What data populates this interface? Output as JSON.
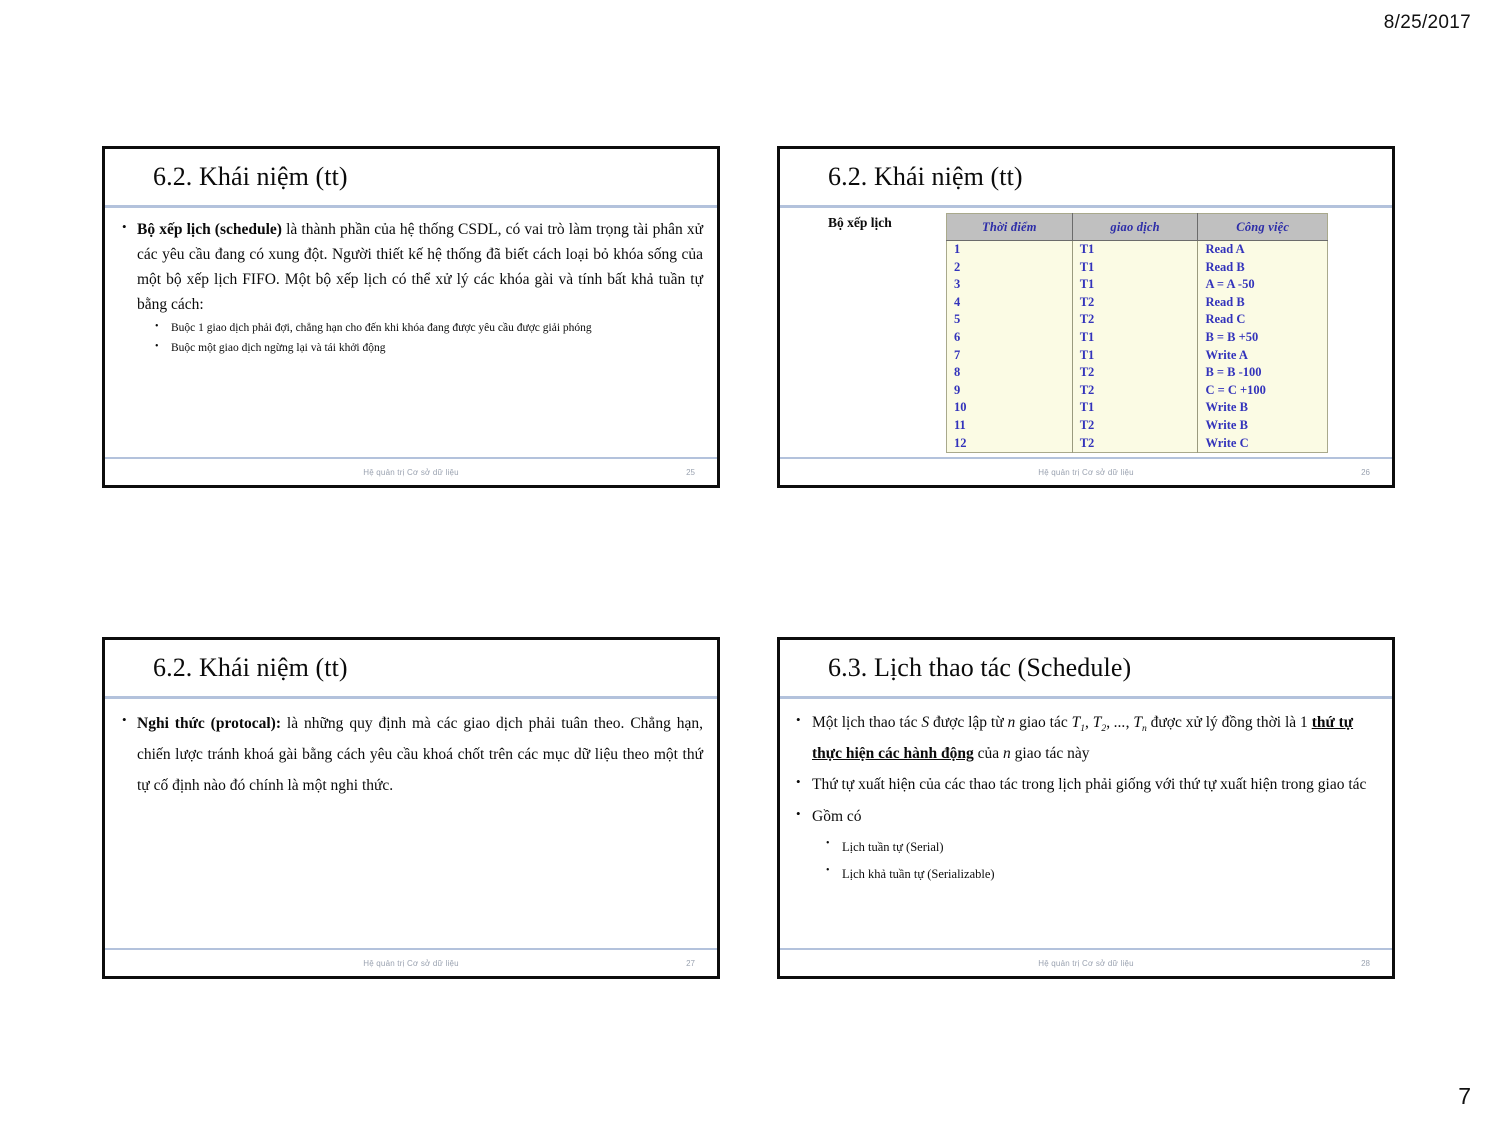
{
  "page": {
    "date": "8/25/2017",
    "number": "7"
  },
  "slides": [
    {
      "id": "slide-25",
      "title": "6.2. Khái niệm (tt)",
      "footer_text": "Hệ quản trị Cơ sở dữ liệu",
      "footer_number": "25",
      "bullets": [
        {
          "level": 1,
          "bold_lead": "Bộ xếp lịch (schedule)",
          "text": " là thành phần của hệ thống  CSDL, có vai trò làm trọng tài phân xử các yêu cầu  đang có xung đột. Người thiết kế hệ thống đã biết cách  loại bỏ khóa sống của một bộ xếp lịch FIFO. Một bộ  xếp lịch có thể xử lý các khóa gài và tính bất khả tuần tự bằng cách:"
        },
        {
          "level": 2,
          "text": "Buộc 1 giao dịch phải đợi, chẳng hạn cho đến khi  khóa đang được yêu cầu được giải phóng"
        },
        {
          "level": 2,
          "text": "Buộc một giao dịch ngừng lại và tái khởi động"
        }
      ]
    },
    {
      "id": "slide-26",
      "title": "6.2. Khái niệm (tt)",
      "footer_text": "Hệ quản trị Cơ sở dữ liệu",
      "footer_number": "26",
      "schedule_label": "Bộ xếp lịch",
      "table": {
        "headers": [
          "Thời điểm",
          "giao dịch",
          "Công việc"
        ],
        "rows": [
          [
            "1",
            "T1",
            "Read A"
          ],
          [
            "2",
            "T1",
            "Read B"
          ],
          [
            "3",
            "T1",
            "A = A -50"
          ],
          [
            "4",
            "T2",
            "Read B"
          ],
          [
            "5",
            "T2",
            "Read C"
          ],
          [
            "6",
            "T1",
            "B = B +50"
          ],
          [
            "7",
            "T1",
            "Write A"
          ],
          [
            "8",
            "T2",
            "B = B -100"
          ],
          [
            "9",
            "T2",
            "C = C +100"
          ],
          [
            "10",
            "T1",
            "Write B"
          ],
          [
            "11",
            "T2",
            "Write B"
          ],
          [
            "12",
            "T2",
            "Write C"
          ]
        ]
      }
    },
    {
      "id": "slide-27",
      "title": "6.2. Khái niệm (tt)",
      "footer_text": "Hệ quản trị Cơ sở dữ liệu",
      "footer_number": "27",
      "bullets": [
        {
          "level": 1,
          "bold_lead": "Nghi thức (protocal):",
          "text": " là những quy định mà các giao dịch phải tuân theo. Chẳng hạn, chiến lược tránh khoá gài bằng cách yêu cầu khoá chốt trên các mục dữ liệu theo một thứ tự cố định nào đó chính là một nghi thức."
        }
      ]
    },
    {
      "id": "slide-28",
      "title": "6.3. Lịch thao tác (Schedule)",
      "footer_text": "Hệ quản trị Cơ sở dữ liệu",
      "footer_number": "28",
      "bullets": [
        {
          "level": 1,
          "parts": [
            {
              "t": "Một lịch thao tác ",
              "style": "normal"
            },
            {
              "t": "S",
              "style": "italic"
            },
            {
              "t": " được lập từ ",
              "style": "normal"
            },
            {
              "t": "n",
              "style": "italic"
            },
            {
              "t": " giao tác ",
              "style": "normal"
            },
            {
              "t": "T1, T2, ..., Tn",
              "style": "italic-sub"
            },
            {
              "t": " được xử lý đồng thời là 1 ",
              "style": "normal"
            },
            {
              "t": "thứ tự thực hiện các hành động",
              "style": "bold-underline"
            },
            {
              "t": " của ",
              "style": "normal"
            },
            {
              "t": "n",
              "style": "italic"
            },
            {
              "t": " giao tác này",
              "style": "normal"
            }
          ]
        },
        {
          "level": 1,
          "text": "Thứ tự xuất hiện của các thao tác trong lịch phải giống với thứ tự xuất hiện trong giao tác"
        },
        {
          "level": 1,
          "text": "Gồm có"
        },
        {
          "level": 2,
          "text": "Lịch tuần tự (Serial)"
        },
        {
          "level": 2,
          "text": "Lịch khả tuần tự (Serializable)"
        }
      ]
    }
  ],
  "colors": {
    "title_rule": "#b3c2dc",
    "slide_border": "#0d0d0d",
    "table_header_bg": "#c0c0c0",
    "table_body_bg": "#fbfbe4",
    "table_text": "#3333bb",
    "footer_text": "#9aa2b0"
  }
}
